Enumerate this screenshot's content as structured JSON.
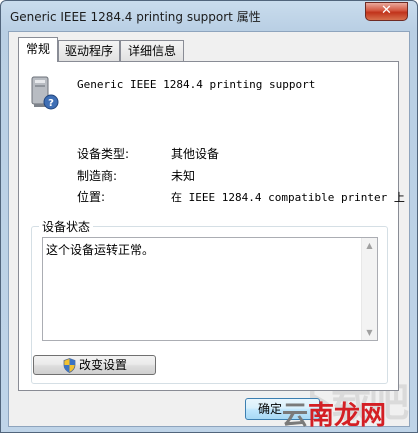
{
  "window": {
    "title": "Generic IEEE 1284.4 printing support 属性",
    "close_label": "✕"
  },
  "tabs": [
    {
      "label": "常规",
      "active": true
    },
    {
      "label": "驱动程序",
      "active": false
    },
    {
      "label": "详细信息",
      "active": false
    }
  ],
  "device": {
    "icon": "printer-device-unknown-icon",
    "name": "Generic IEEE 1284.4 printing support"
  },
  "properties": [
    {
      "label": "设备类型:",
      "value": "其他设备"
    },
    {
      "label": "制造商:",
      "value": "未知"
    },
    {
      "label": "位置:",
      "value": "在 IEEE 1284.4 compatible printer 上"
    }
  ],
  "status": {
    "legend": "设备状态",
    "text": "这个设备运转正常。"
  },
  "buttons": {
    "change_settings": "改变设置",
    "ok": "确定"
  },
  "watermark": {
    "text_faint": "下载吧",
    "text_main_prefix": "云",
    "text_main_suffix": "南龙网"
  }
}
